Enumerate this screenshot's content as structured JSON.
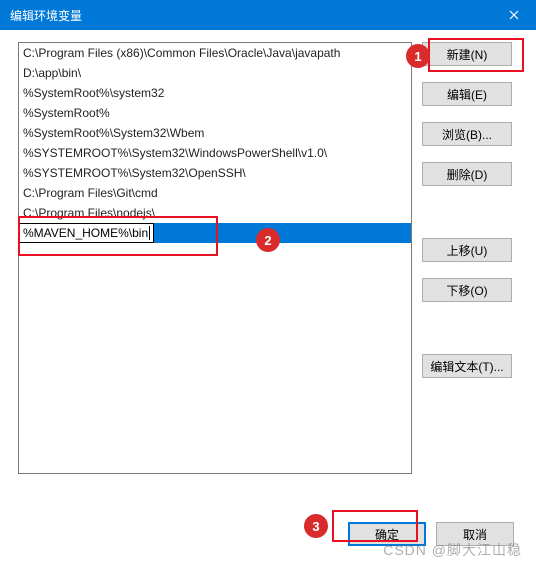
{
  "titlebar": {
    "title": "编辑环境变量"
  },
  "list": {
    "items": [
      "C:\\Program Files (x86)\\Common Files\\Oracle\\Java\\javapath",
      "D:\\app\\bin\\",
      "%SystemRoot%\\system32",
      "%SystemRoot%",
      "%SystemRoot%\\System32\\Wbem",
      "%SYSTEMROOT%\\System32\\WindowsPowerShell\\v1.0\\",
      "%SYSTEMROOT%\\System32\\OpenSSH\\",
      "C:\\Program Files\\Git\\cmd",
      "C:\\Program Files\\nodejs\\"
    ],
    "editing_value": "%MAVEN_HOME%\\bin"
  },
  "buttons": {
    "new": "新建(N)",
    "edit": "编辑(E)",
    "browse": "浏览(B)...",
    "delete": "删除(D)",
    "moveup": "上移(U)",
    "movedown": "下移(O)",
    "edittext": "编辑文本(T)..."
  },
  "bottom": {
    "ok": "确定",
    "cancel": "取消"
  },
  "badges": {
    "one": "1",
    "two": "2",
    "three": "3"
  },
  "watermark": "CSDN @脚大江山稳"
}
